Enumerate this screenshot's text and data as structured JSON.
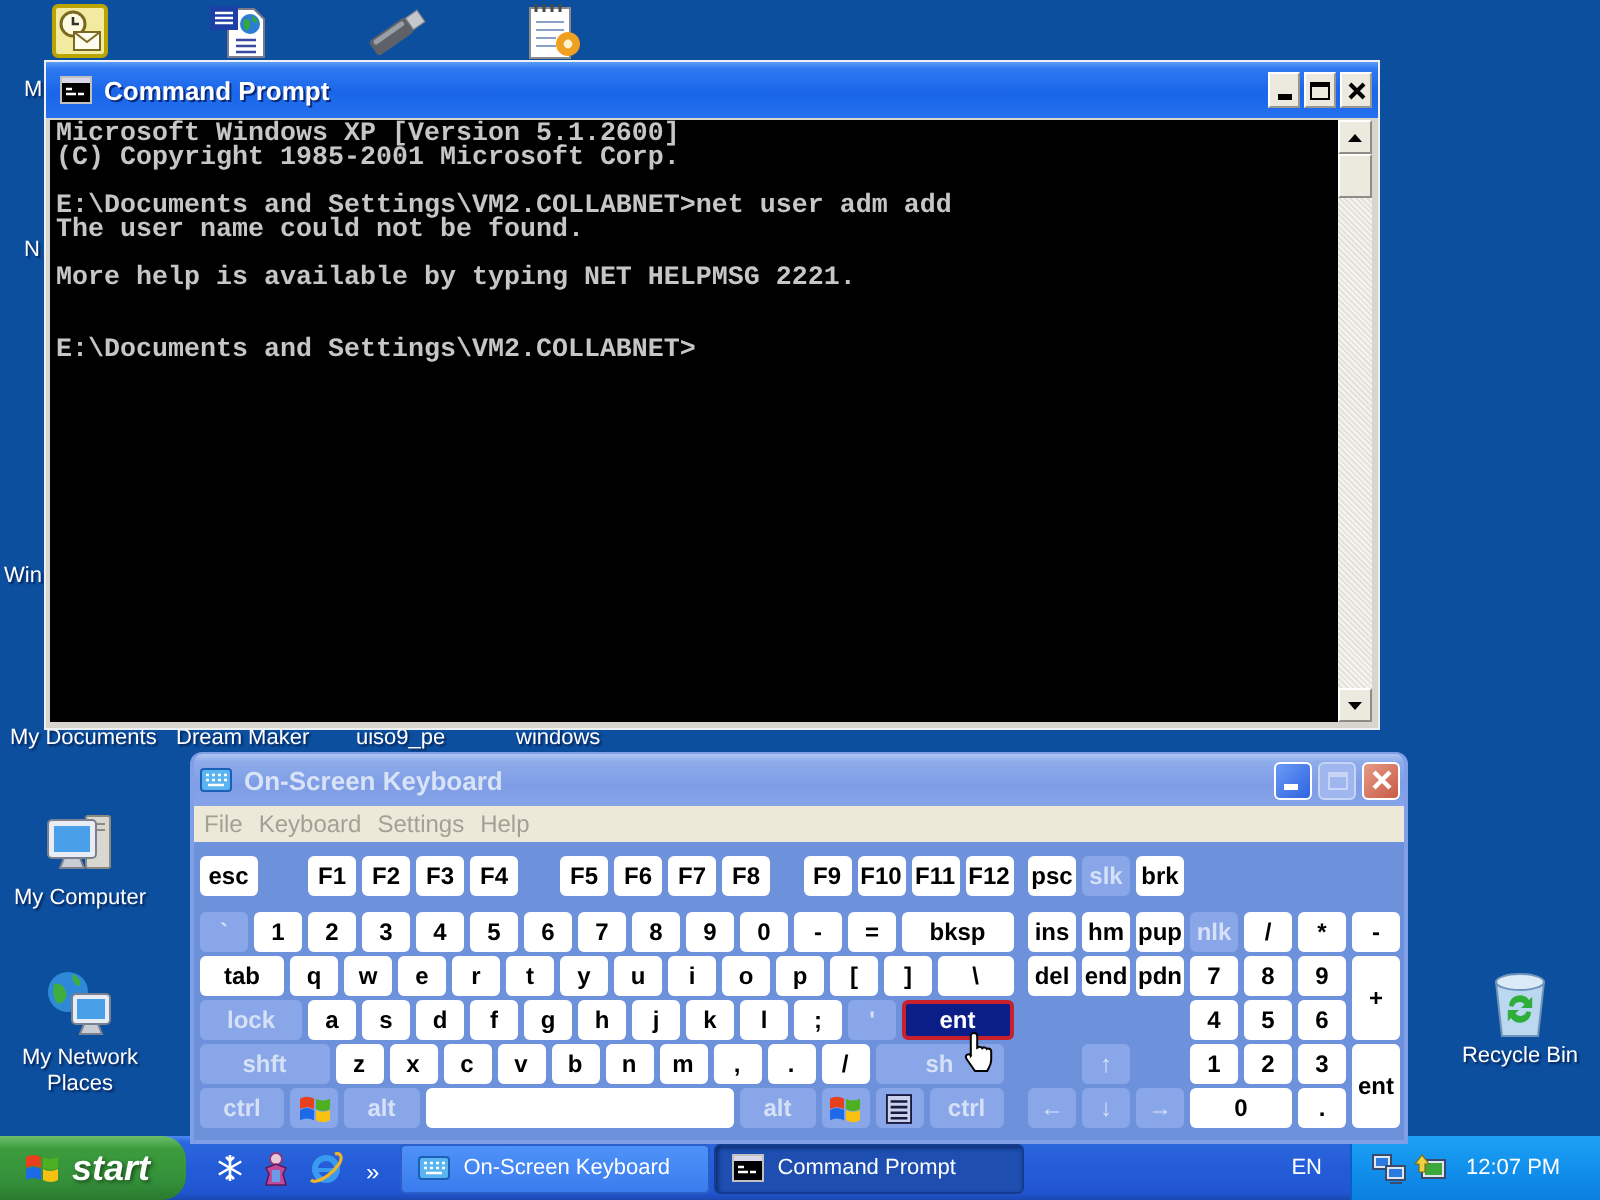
{
  "desktop": {
    "partial_labels": [
      "M",
      "N",
      "Win",
      "My Documents",
      "Dream Maker",
      "uiso9_pe",
      "windows"
    ],
    "icons": [
      {
        "kind": "clock_card"
      },
      {
        "kind": "word_document"
      },
      {
        "kind": "usb_stick"
      },
      {
        "kind": "notepad"
      },
      {
        "kind": "computer",
        "label": "My Computer"
      },
      {
        "kind": "network",
        "label": "My Network Places"
      },
      {
        "kind": "recycle_bin",
        "label": "Recycle Bin"
      }
    ]
  },
  "command_prompt": {
    "title": "Command Prompt",
    "active": true,
    "window_buttons": [
      {
        "kind": "minimize",
        "disabled": false
      },
      {
        "kind": "maximize",
        "disabled": false
      },
      {
        "kind": "close",
        "disabled": false
      }
    ],
    "lines": [
      {
        "kind": "text",
        "text": "Microsoft Windows XP [Version 5.1.2600]"
      },
      {
        "kind": "text",
        "text": "(C) Copyright 1985-2001 Microsoft Corp."
      },
      {
        "kind": "blank"
      },
      {
        "kind": "text",
        "text": "E:\\Documents and Settings\\VM2.COLLABNET>net user adm add"
      },
      {
        "kind": "text",
        "text": "The user name could not be found."
      },
      {
        "kind": "blank"
      },
      {
        "kind": "text",
        "text": "More help is available by typing NET HELPMSG 2221."
      },
      {
        "kind": "blank"
      },
      {
        "kind": "blank"
      },
      {
        "kind": "text",
        "text": "E:\\Documents and Settings\\VM2.COLLABNET>"
      }
    ]
  },
  "on_screen_keyboard": {
    "title": "On-Screen Keyboard",
    "active": false,
    "window_buttons": [
      {
        "kind": "minimize",
        "disabled": false
      },
      {
        "kind": "maximize",
        "disabled": true
      },
      {
        "kind": "close",
        "disabled": false
      }
    ],
    "menu": [
      {
        "label": "File",
        "disabled": true
      },
      {
        "label": "Keyboard",
        "disabled": true
      },
      {
        "label": "Settings",
        "disabled": true
      },
      {
        "label": "Help",
        "disabled": true
      }
    ],
    "key_rows": [
      {
        "keys": [
          {
            "kind": "text",
            "label": "esc",
            "dimmed": false,
            "hovered": false
          },
          {
            "kind": "text",
            "label": "F1",
            "dimmed": false,
            "hovered": false
          },
          {
            "kind": "text",
            "label": "F2",
            "dimmed": false,
            "hovered": false
          },
          {
            "kind": "text",
            "label": "F3",
            "dimmed": false,
            "hovered": false
          },
          {
            "kind": "text",
            "label": "F4",
            "dimmed": false,
            "hovered": false
          },
          {
            "kind": "text",
            "label": "F5",
            "dimmed": false,
            "hovered": false
          },
          {
            "kind": "text",
            "label": "F6",
            "dimmed": false,
            "hovered": false
          },
          {
            "kind": "text",
            "label": "F7",
            "dimmed": false,
            "hovered": false
          },
          {
            "kind": "text",
            "label": "F8",
            "dimmed": false,
            "hovered": false
          },
          {
            "kind": "text",
            "label": "F9",
            "dimmed": false,
            "hovered": false
          },
          {
            "kind": "text",
            "label": "F10",
            "dimmed": false,
            "hovered": false
          },
          {
            "kind": "text",
            "label": "F11",
            "dimmed": false,
            "hovered": false
          },
          {
            "kind": "text",
            "label": "F12",
            "dimmed": false,
            "hovered": false
          },
          {
            "kind": "text",
            "label": "psc",
            "dimmed": false,
            "hovered": false
          },
          {
            "kind": "text",
            "label": "slk",
            "dimmed": true,
            "hovered": false
          },
          {
            "kind": "text",
            "label": "brk",
            "dimmed": false,
            "hovered": false
          }
        ]
      },
      {
        "keys": [
          {
            "kind": "text",
            "label": "`",
            "dimmed": true,
            "hovered": false
          },
          {
            "kind": "text",
            "label": "1",
            "dimmed": false,
            "hovered": false
          },
          {
            "kind": "text",
            "label": "2",
            "dimmed": false,
            "hovered": false
          },
          {
            "kind": "text",
            "label": "3",
            "dimmed": false,
            "hovered": false
          },
          {
            "kind": "text",
            "label": "4",
            "dimmed": false,
            "hovered": false
          },
          {
            "kind": "text",
            "label": "5",
            "dimmed": false,
            "hovered": false
          },
          {
            "kind": "text",
            "label": "6",
            "dimmed": false,
            "hovered": false
          },
          {
            "kind": "text",
            "label": "7",
            "dimmed": false,
            "hovered": false
          },
          {
            "kind": "text",
            "label": "8",
            "dimmed": false,
            "hovered": false
          },
          {
            "kind": "text",
            "label": "9",
            "dimmed": false,
            "hovered": false
          },
          {
            "kind": "text",
            "label": "0",
            "dimmed": false,
            "hovered": false
          },
          {
            "kind": "text",
            "label": "-",
            "dimmed": false,
            "hovered": false
          },
          {
            "kind": "text",
            "label": "=",
            "dimmed": false,
            "hovered": false
          },
          {
            "kind": "text",
            "label": "bksp",
            "dimmed": false,
            "hovered": false
          },
          {
            "kind": "text",
            "label": "ins",
            "dimmed": false,
            "hovered": false
          },
          {
            "kind": "text",
            "label": "hm",
            "dimmed": false,
            "hovered": false
          },
          {
            "kind": "text",
            "label": "pup",
            "dimmed": false,
            "hovered": false
          },
          {
            "kind": "text",
            "label": "nlk",
            "dimmed": true,
            "hovered": false
          },
          {
            "kind": "text",
            "label": "/",
            "dimmed": false,
            "hovered": false
          },
          {
            "kind": "text",
            "label": "*",
            "dimmed": false,
            "hovered": false
          },
          {
            "kind": "text",
            "label": "-",
            "dimmed": false,
            "hovered": false
          }
        ]
      },
      {
        "keys": [
          {
            "kind": "text",
            "label": "tab",
            "dimmed": false,
            "hovered": false
          },
          {
            "kind": "text",
            "label": "q",
            "dimmed": false,
            "hovered": false
          },
          {
            "kind": "text",
            "label": "w",
            "dimmed": false,
            "hovered": false
          },
          {
            "kind": "text",
            "label": "e",
            "dimmed": false,
            "hovered": false
          },
          {
            "kind": "text",
            "label": "r",
            "dimmed": false,
            "hovered": false
          },
          {
            "kind": "text",
            "label": "t",
            "dimmed": false,
            "hovered": false
          },
          {
            "kind": "text",
            "label": "y",
            "dimmed": false,
            "hovered": false
          },
          {
            "kind": "text",
            "label": "u",
            "dimmed": false,
            "hovered": false
          },
          {
            "kind": "text",
            "label": "i",
            "dimmed": false,
            "hovered": false
          },
          {
            "kind": "text",
            "label": "o",
            "dimmed": false,
            "hovered": false
          },
          {
            "kind": "text",
            "label": "p",
            "dimmed": false,
            "hovered": false
          },
          {
            "kind": "text",
            "label": "[",
            "dimmed": false,
            "hovered": false
          },
          {
            "kind": "text",
            "label": "]",
            "dimmed": false,
            "hovered": false
          },
          {
            "kind": "text",
            "label": "\\",
            "dimmed": false,
            "hovered": false
          },
          {
            "kind": "text",
            "label": "del",
            "dimmed": false,
            "hovered": false
          },
          {
            "kind": "text",
            "label": "end",
            "dimmed": false,
            "hovered": false
          },
          {
            "kind": "text",
            "label": "pdn",
            "dimmed": false,
            "hovered": false
          },
          {
            "kind": "text",
            "label": "7",
            "dimmed": false,
            "hovered": false
          },
          {
            "kind": "text",
            "label": "8",
            "dimmed": false,
            "hovered": false
          },
          {
            "kind": "text",
            "label": "9",
            "dimmed": false,
            "hovered": false
          },
          {
            "kind": "text",
            "label": "+",
            "dimmed": false,
            "hovered": false
          }
        ]
      },
      {
        "keys": [
          {
            "kind": "text",
            "label": "lock",
            "dimmed": true,
            "hovered": false
          },
          {
            "kind": "text",
            "label": "a",
            "dimmed": false,
            "hovered": false
          },
          {
            "kind": "text",
            "label": "s",
            "dimmed": false,
            "hovered": false
          },
          {
            "kind": "text",
            "label": "d",
            "dimmed": false,
            "hovered": false
          },
          {
            "kind": "text",
            "label": "f",
            "dimmed": false,
            "hovered": false
          },
          {
            "kind": "text",
            "label": "g",
            "dimmed": false,
            "hovered": false
          },
          {
            "kind": "text",
            "label": "h",
            "dimmed": false,
            "hovered": false
          },
          {
            "kind": "text",
            "label": "j",
            "dimmed": false,
            "hovered": false
          },
          {
            "kind": "text",
            "label": "k",
            "dimmed": false,
            "hovered": false
          },
          {
            "kind": "text",
            "label": "l",
            "dimmed": false,
            "hovered": false
          },
          {
            "kind": "text",
            "label": ";",
            "dimmed": false,
            "hovered": false
          },
          {
            "kind": "text",
            "label": "'",
            "dimmed": true,
            "hovered": false
          },
          {
            "kind": "text",
            "label": "ent",
            "dimmed": false,
            "hovered": true
          },
          {
            "kind": "text",
            "label": "4",
            "dimmed": false,
            "hovered": false
          },
          {
            "kind": "text",
            "label": "5",
            "dimmed": false,
            "hovered": false
          },
          {
            "kind": "text",
            "label": "6",
            "dimmed": false,
            "hovered": false
          }
        ]
      },
      {
        "keys": [
          {
            "kind": "text",
            "label": "shft",
            "dimmed": true,
            "hovered": false
          },
          {
            "kind": "text",
            "label": "z",
            "dimmed": false,
            "hovered": false
          },
          {
            "kind": "text",
            "label": "x",
            "dimmed": false,
            "hovered": false
          },
          {
            "kind": "text",
            "label": "c",
            "dimmed": false,
            "hovered": false
          },
          {
            "kind": "text",
            "label": "v",
            "dimmed": false,
            "hovered": false
          },
          {
            "kind": "text",
            "label": "b",
            "dimmed": false,
            "hovered": false
          },
          {
            "kind": "text",
            "label": "n",
            "dimmed": false,
            "hovered": false
          },
          {
            "kind": "text",
            "label": "m",
            "dimmed": false,
            "hovered": false
          },
          {
            "kind": "text",
            "label": ",",
            "dimmed": false,
            "hovered": false
          },
          {
            "kind": "text",
            "label": ".",
            "dimmed": false,
            "hovered": false
          },
          {
            "kind": "text",
            "label": "/",
            "dimmed": false,
            "hovered": false
          },
          {
            "kind": "text",
            "label": "sh",
            "dimmed": true,
            "hovered": false
          },
          {
            "kind": "text",
            "label": "↑",
            "dimmed": true,
            "hovered": false
          },
          {
            "kind": "text",
            "label": "1",
            "dimmed": false,
            "hovered": false
          },
          {
            "kind": "text",
            "label": "2",
            "dimmed": false,
            "hovered": false
          },
          {
            "kind": "text",
            "label": "3",
            "dimmed": false,
            "hovered": false
          },
          {
            "kind": "text",
            "label": "ent",
            "dimmed": false,
            "hovered": false
          }
        ]
      },
      {
        "keys": [
          {
            "kind": "text",
            "label": "ctrl",
            "dimmed": true,
            "hovered": false
          },
          {
            "kind": "windows",
            "dimmed": true,
            "hovered": false
          },
          {
            "kind": "text",
            "label": "alt",
            "dimmed": true,
            "hovered": false
          },
          {
            "kind": "space",
            "dimmed": false,
            "hovered": false
          },
          {
            "kind": "text",
            "label": "alt",
            "dimmed": true,
            "hovered": false
          },
          {
            "kind": "windows",
            "dimmed": true,
            "hovered": false
          },
          {
            "kind": "menu",
            "dimmed": true,
            "hovered": false
          },
          {
            "kind": "text",
            "label": "ctrl",
            "dimmed": true,
            "hovered": false
          },
          {
            "kind": "text",
            "label": "←",
            "dimmed": true,
            "hovered": false
          },
          {
            "kind": "text",
            "label": "↓",
            "dimmed": true,
            "hovered": false
          },
          {
            "kind": "text",
            "label": "→",
            "dimmed": true,
            "hovered": false
          },
          {
            "kind": "text",
            "label": "0",
            "dimmed": false,
            "hovered": false
          },
          {
            "kind": "text",
            "label": ".",
            "dimmed": false,
            "hovered": false
          }
        ]
      }
    ]
  },
  "taskbar": {
    "start": "start",
    "quick_launch": [
      {
        "kind": "snowflake"
      },
      {
        "kind": "figure"
      },
      {
        "kind": "browser"
      }
    ],
    "overflow": "»",
    "buttons": [
      {
        "kind": "keyboard",
        "label": "On-Screen Keyboard",
        "selected": false
      },
      {
        "kind": "console",
        "label": "Command Prompt",
        "selected": true
      }
    ],
    "language": "EN",
    "tray_icons": [
      {
        "kind": "network"
      },
      {
        "kind": "display"
      }
    ],
    "clock": "12:07 PM"
  }
}
